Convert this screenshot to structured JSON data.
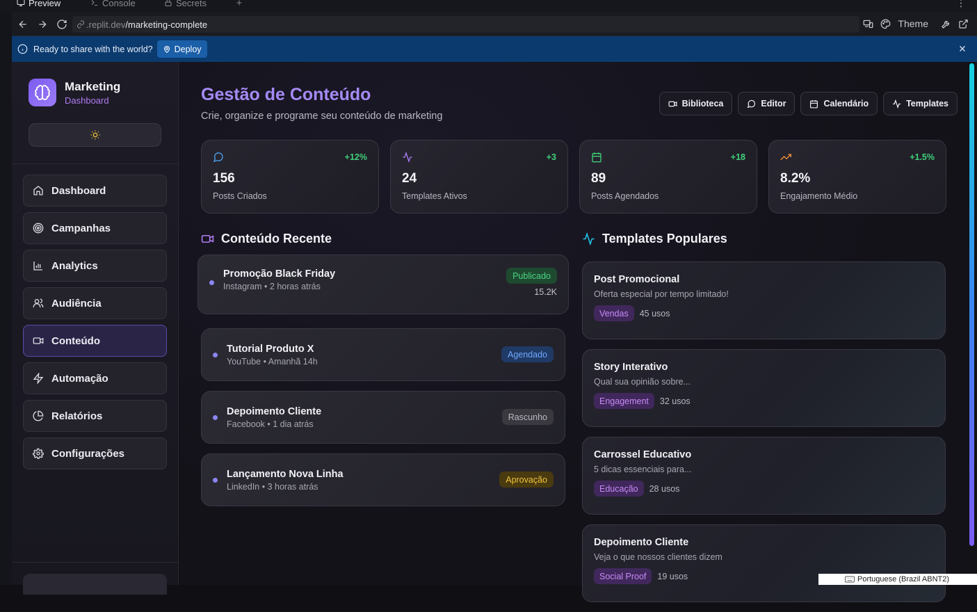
{
  "browser": {
    "tabs": [
      {
        "label": "Preview",
        "icon": "monitor-icon"
      },
      {
        "label": "Console",
        "icon": "terminal-icon"
      },
      {
        "label": "Secrets",
        "icon": "lock-icon"
      }
    ],
    "url_domain": ".replit.dev",
    "url_path": "/marketing-complete",
    "theme_label": "Theme"
  },
  "deploy_banner": {
    "message": "Ready to share with the world?",
    "button": "Deploy"
  },
  "sidebar": {
    "brand_title": "Marketing",
    "brand_subtitle": "Dashboard",
    "items": [
      {
        "label": "Dashboard",
        "icon": "home-icon"
      },
      {
        "label": "Campanhas",
        "icon": "target-icon"
      },
      {
        "label": "Analytics",
        "icon": "bar-chart-icon"
      },
      {
        "label": "Audiência",
        "icon": "users-icon"
      },
      {
        "label": "Conteúdo",
        "icon": "video-icon",
        "active": true
      },
      {
        "label": "Automação",
        "icon": "zap-icon"
      },
      {
        "label": "Relatórios",
        "icon": "pie-chart-icon"
      },
      {
        "label": "Configurações",
        "icon": "settings-icon"
      }
    ]
  },
  "header": {
    "title": "Gestão de Conteúdo",
    "subtitle": "Crie, organize e programe seu conteúdo de marketing",
    "actions": [
      "Biblioteca",
      "Editor",
      "Calendário",
      "Templates"
    ]
  },
  "stats": [
    {
      "value": "156",
      "label": "Posts Criados",
      "delta": "+12%",
      "icon": "message-icon",
      "color": "#4aa3f0"
    },
    {
      "value": "24",
      "label": "Templates Ativos",
      "delta": "+3",
      "icon": "activity-icon",
      "color": "#a77cf5"
    },
    {
      "value": "89",
      "label": "Posts Agendados",
      "delta": "+18",
      "icon": "calendar-icon",
      "color": "#3fd07a"
    },
    {
      "value": "8.2%",
      "label": "Engajamento Médio",
      "delta": "+1.5%",
      "icon": "trending-up-icon",
      "color": "#f0913a"
    }
  ],
  "recent": {
    "title": "Conteúdo Recente",
    "items": [
      {
        "title": "Promoção Black Friday",
        "meta": "Instagram • 2 horas atrás",
        "status": "Publicado",
        "metric": "15.2K",
        "status_bg": "#1e4a30",
        "status_fg": "#4bd583"
      },
      {
        "title": "Tutorial Produto X",
        "meta": "YouTube • Amanhã 14h",
        "status": "Agendado",
        "status_bg": "#203a66",
        "status_fg": "#6ea8ff"
      },
      {
        "title": "Depoimento Cliente",
        "meta": "Facebook • 1 dia atrás",
        "status": "Rascunho",
        "status_bg": "#3a3940",
        "status_fg": "#b7b7c2"
      },
      {
        "title": "Lançamento Nova Linha",
        "meta": "LinkedIn • 3 horas atrás",
        "status": "Aprovação",
        "status_bg": "#4a3a10",
        "status_fg": "#f0c33a"
      }
    ]
  },
  "templates": {
    "title": "Templates Populares",
    "items": [
      {
        "title": "Post Promocional",
        "desc": "Oferta especial por tempo limitado!",
        "tag": "Vendas",
        "uses": "45 usos"
      },
      {
        "title": "Story Interativo",
        "desc": "Qual sua opinião sobre...",
        "tag": "Engagement",
        "uses": "32 usos"
      },
      {
        "title": "Carrossel Educativo",
        "desc": "5 dicas essenciais para...",
        "tag": "Educação",
        "uses": "28 usos"
      },
      {
        "title": "Depoimento Cliente",
        "desc": "Veja o que nossos clientes dizem",
        "tag": "Social Proof",
        "uses": "19 usos"
      }
    ]
  },
  "keyboard_popup": "Portuguese (Brazil ABNT2)"
}
